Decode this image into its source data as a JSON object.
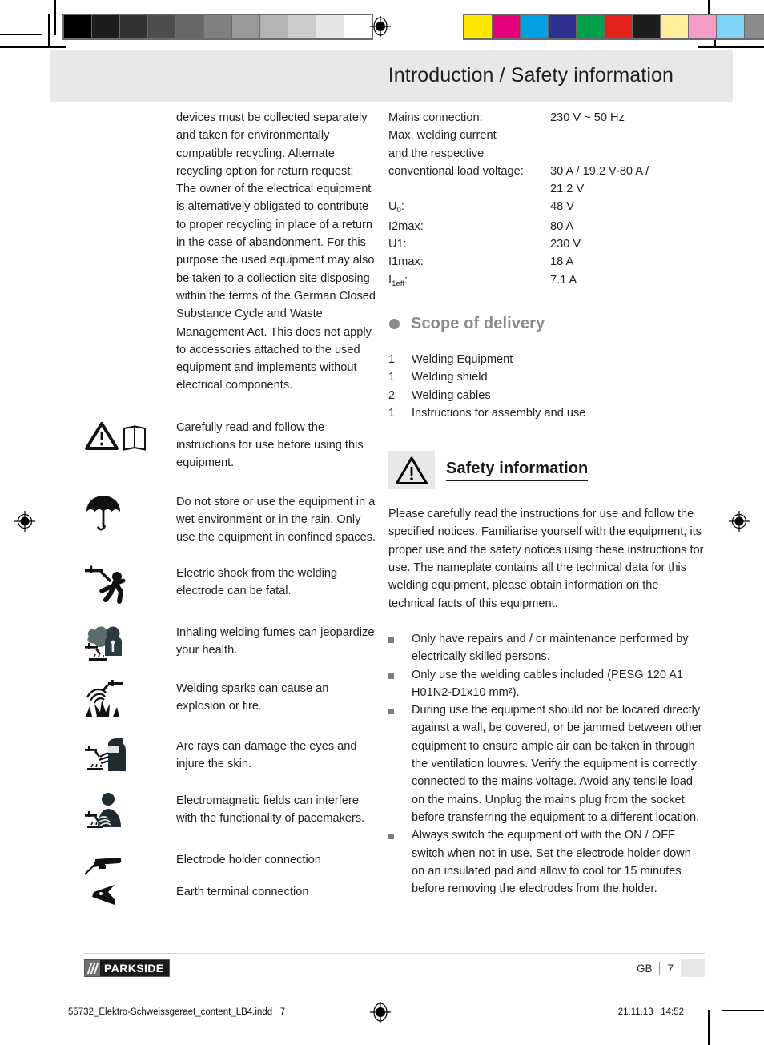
{
  "header": {
    "title": "Introduction / Safety information"
  },
  "left_column": {
    "disposal_paragraph": "devices must be collected separately and taken for environmentally compatible recycling. Alternate recycling option for return request:\nThe owner of the electrical equipment is alternatively obligated to contribute to proper recycling in place of a return in the case of abandonment. For this purpose the used equipment may also be taken to a collection site disposing within the terms of the German Closed  Substance Cycle and Waste Management Act. This does not apply to accessories attached to the used equipment and implements without electrical components.",
    "pictograms": [
      {
        "icon": "warning-triangle-and-manual-icon",
        "text": "Carefully read and follow the instructions for use before using this equipment."
      },
      {
        "icon": "umbrella-keep-dry-icon",
        "text": "Do not store or use the equipment in a wet environment or in the rain. Only use the equipment in confined spaces."
      },
      {
        "icon": "electric-shock-hazard-icon",
        "text": "Electric shock from the welding electrode can be fatal."
      },
      {
        "icon": "welding-fumes-hazard-icon",
        "text": "Inhaling welding fumes can jeopardize your health."
      },
      {
        "icon": "welding-sparks-fire-hazard-icon",
        "text": "Welding sparks can cause an explosion or fire."
      },
      {
        "icon": "arc-rays-eye-hazard-icon",
        "text": "Arc rays can damage the eyes and injure the skin."
      },
      {
        "icon": "electromagnetic-field-pacemaker-icon",
        "text": "Electromagnetic fields can interfere with the functionality of pacemakers."
      },
      {
        "icon": "electrode-holder-icon",
        "text": "Electrode holder connection"
      },
      {
        "icon": "earth-clamp-icon",
        "text": "Earth terminal connection"
      }
    ]
  },
  "specs": {
    "rows": [
      {
        "label": "Mains connection:",
        "value": "230 V ~ 50 Hz"
      },
      {
        "label": "Max. welding current",
        "value": ""
      },
      {
        "label": "and the respective",
        "value": ""
      },
      {
        "label": "conventional load voltage:",
        "value": "30 A / 19.2 V-80 A /\n21.2 V"
      },
      {
        "label": "U0:",
        "label_base": "U",
        "label_sub": "0",
        "label_tail": ":",
        "value": "48 V"
      },
      {
        "label": "I2max:",
        "value": "80 A"
      },
      {
        "label": "U1:",
        "value": "230 V"
      },
      {
        "label": "I1max:",
        "value": "18 A"
      },
      {
        "label": "I1eff:",
        "label_base": "I",
        "label_sub": "1eff",
        "label_tail": ":",
        "value": "7.1 A"
      }
    ]
  },
  "scope_of_delivery": {
    "heading": "Scope of delivery",
    "items": [
      {
        "qty": "1",
        "name": "Welding Equipment"
      },
      {
        "qty": "1",
        "name": "Welding shield"
      },
      {
        "qty": "2",
        "name": "Welding cables"
      },
      {
        "qty": "1",
        "name": "Instructions for assembly and use"
      }
    ]
  },
  "safety_information": {
    "heading": "Safety information",
    "intro": "Please carefully read the instructions for use and follow the specified notices. Familiarise yourself with the equipment, its proper use and the safety notices using these instructions for use. The nameplate contains all the technical data for this welding equipment, please obtain information on the technical facts of this equipment.",
    "bullets": [
      "Only have repairs and / or maintenance performed by electrically skilled persons.",
      "Only use the welding cables included (PESG 120 A1 H01N2-D1x10 mm²).",
      "During use the equipment should not be located directly against a wall, be covered, or be jammed between other equipment to ensure ample air can be taken in through the ventilation louvres. Verify the equipment is correctly connected to the mains voltage. Avoid any tensile load on the mains. Unplug the mains plug from the socket before transferring the equipment to a different location.",
      "Always switch the equipment off with the ON / OFF switch when not in use. Set the electrode holder down on an insulated pad and allow to cool for 15 minutes before removing the electrodes from the holder."
    ]
  },
  "footer": {
    "brand": "PARKSIDE",
    "locale": "GB",
    "page_number": "7",
    "file_name": "55732_Elektro-Schweissgeraet_content_LB4.indd",
    "file_page": "7",
    "print_date": "21.11.13",
    "print_time": "14:52"
  },
  "prepress": {
    "gray_ramp": [
      "#000000",
      "#1c1c1c",
      "#333333",
      "#4d4d4d",
      "#666666",
      "#808080",
      "#999999",
      "#b3b3b3",
      "#cccccc",
      "#e6e6e6",
      "#ffffff"
    ],
    "color_patches": [
      "#ffe600",
      "#e5007e",
      "#00a0e3",
      "#2e3192",
      "#00a14b",
      "#e32119",
      "#1d1d1b",
      "#fcee9b",
      "#f59bc8",
      "#7fd3f5",
      "#8c8c8c"
    ]
  }
}
